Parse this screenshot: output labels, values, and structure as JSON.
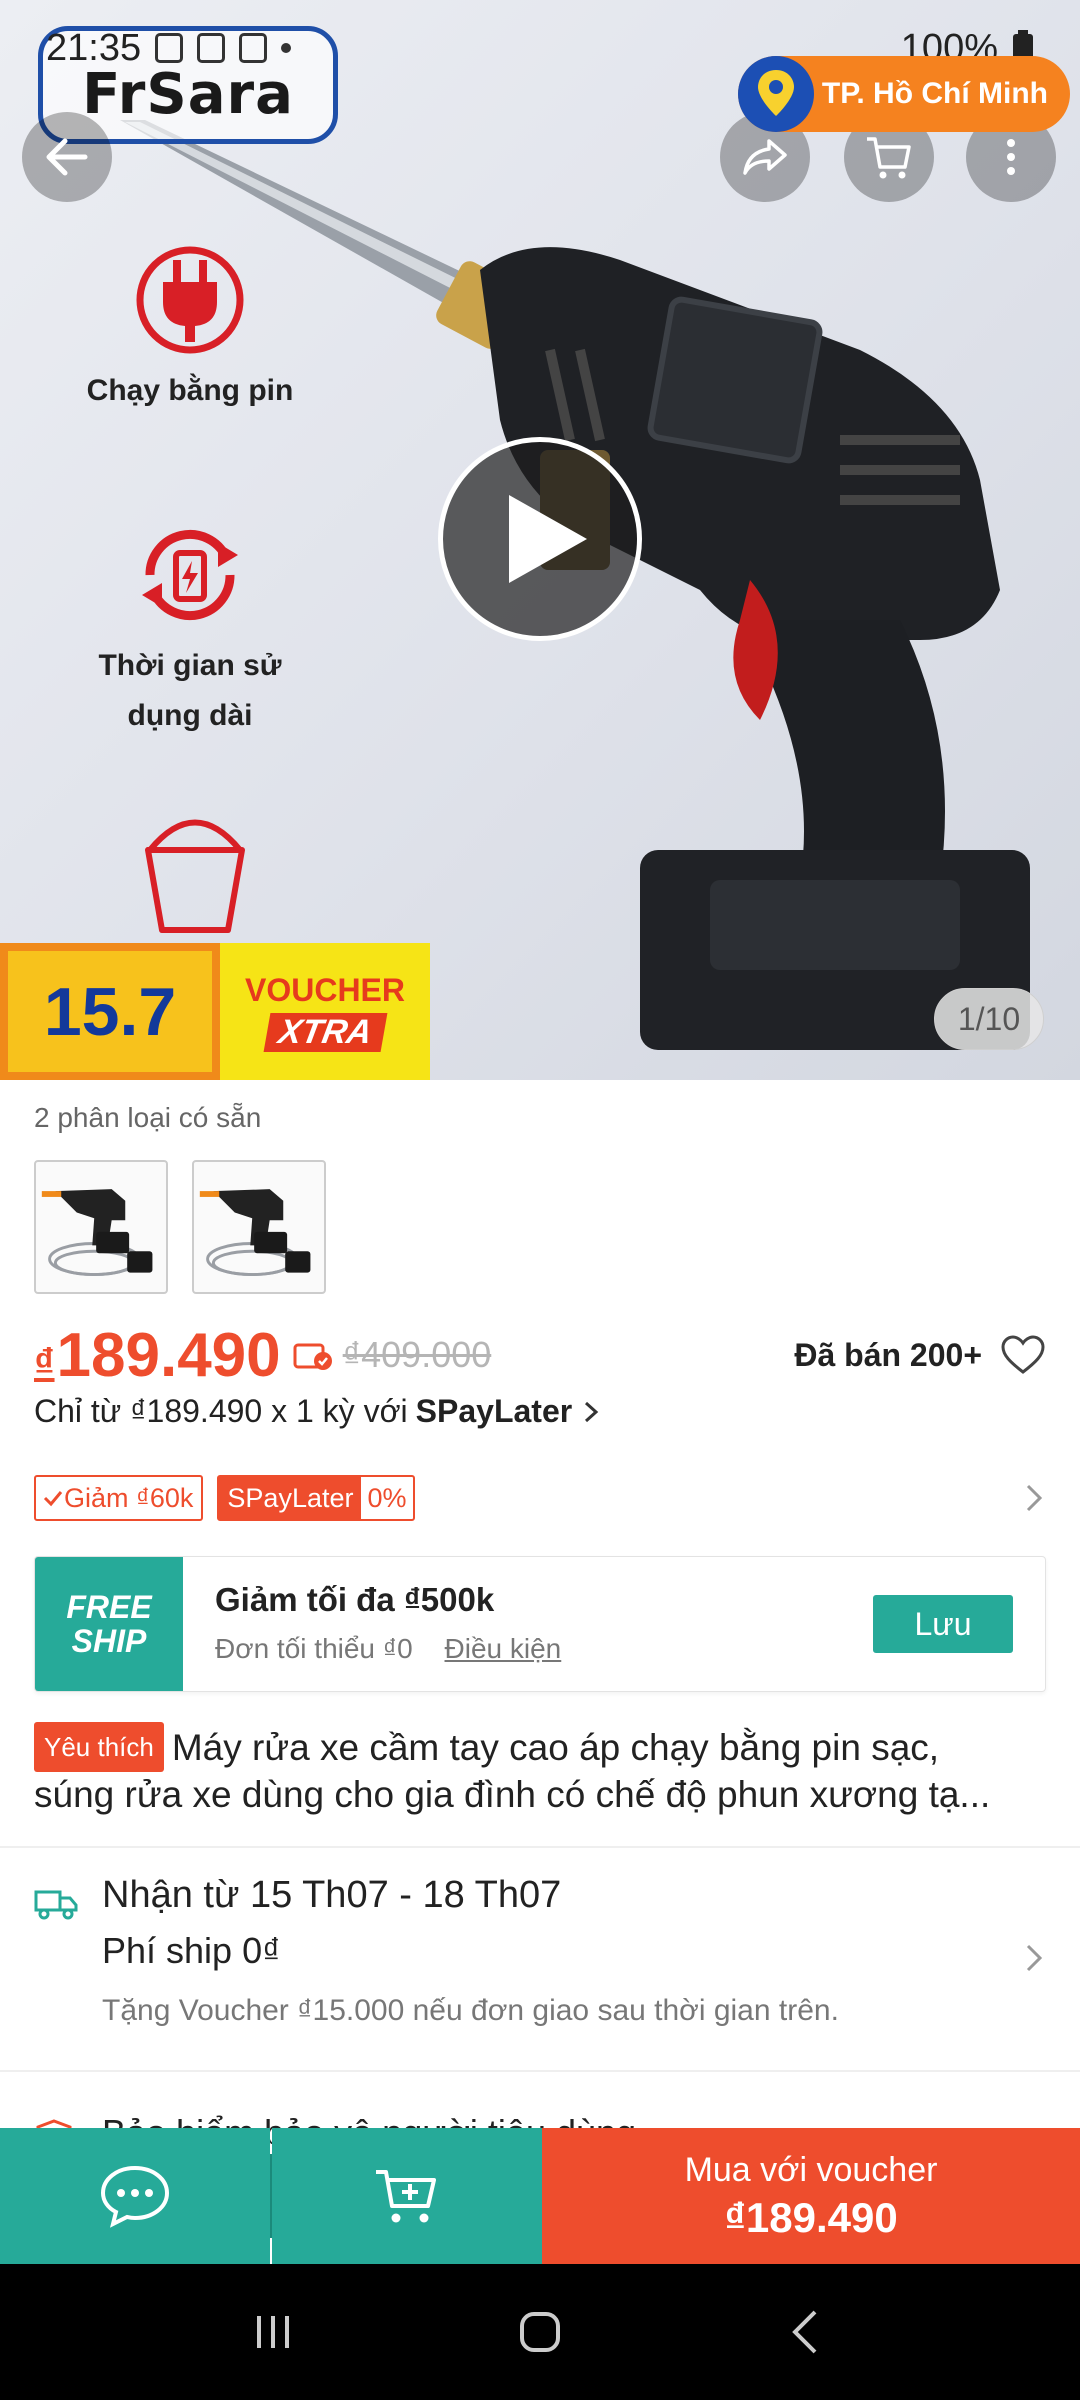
{
  "status_bar": {
    "time": "21:35",
    "battery": "100%"
  },
  "brand": {
    "name": "FrSara"
  },
  "location": {
    "label": "TP. Hồ Chí Minh"
  },
  "hero": {
    "features": [
      "Chạy bằng pin",
      "Thời gian sử dụng dài"
    ],
    "voucher_banner": {
      "number": "15.7",
      "line1": "VOUCHER",
      "line2": "XTRA"
    },
    "image_counter": "1/10"
  },
  "variants": {
    "label": "2 phân loại có sẵn",
    "count": 2
  },
  "price": {
    "currency": "₫",
    "current": "189.490",
    "original": "₫409.000",
    "sold": "Đã bán 200+"
  },
  "spaylater": {
    "text": "Chỉ từ ₫189.490 x 1 kỳ với",
    "brand": "SPayLater"
  },
  "promo_tags": {
    "discount": "Giảm ₫60k",
    "spay_label": "SPayLater",
    "spay_rate": "0%"
  },
  "freeship": {
    "logo_line1": "FREE",
    "logo_line2": "SHIP",
    "title": "Giảm tối đa ₫500k",
    "min_order": "Đơn tối thiểu ₫0",
    "conditions_link": "Điều kiện",
    "save_button": "Lưu"
  },
  "product": {
    "badge": "Yêu thích",
    "title_line1": "Máy rửa xe cầm tay cao áp chạy bằng pin sạc,",
    "title_line2": "súng rửa xe dùng cho gia đình có chế độ phun xương tạ..."
  },
  "shipping": {
    "delivery": "Nhận từ 15 Th07 - 18 Th07",
    "fee": "Phí ship 0₫",
    "voucher_note": "Tặng Voucher ₫15.000 nếu đơn giao sau thời gian trên."
  },
  "insurance": {
    "label": "Bảo hiểm bảo vệ người tiêu dùng"
  },
  "action_bar": {
    "buy_line1": "Mua với voucher",
    "buy_line2": "₫189.490"
  },
  "colors": {
    "primary": "#ee4d2d",
    "teal": "#26aa99",
    "location_badge": "#f5821f"
  }
}
